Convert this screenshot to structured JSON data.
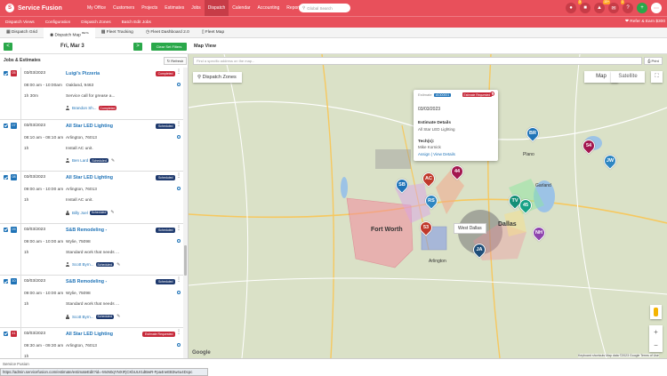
{
  "app": {
    "brand": "Service Fusion",
    "logo_letter": "S",
    "brand_color": "#e8505b"
  },
  "nav": {
    "items": [
      "My Office",
      "Customers",
      "Projects",
      "Estimates",
      "Jobs",
      "Dispatch",
      "Calendar",
      "Accounting",
      "Reports"
    ],
    "active": "Dispatch"
  },
  "search": {
    "placeholder": "Global Search",
    "icon": "search-icon"
  },
  "topicons": {
    "badge1": "3",
    "badge2": "10+",
    "badge3": "1"
  },
  "subnav": {
    "items": [
      "Dispatch Views",
      "Configuration",
      "Dispatch Zones",
      "Batch Edit Jobs"
    ],
    "refer": "Refer & Earn $300"
  },
  "tabs": {
    "items": [
      "Dispatch Grid",
      "Dispatch Map",
      "Fleet Tracking",
      "Fleet Dashboard 2.0",
      "Fleet Map"
    ],
    "beta": "BETA"
  },
  "controls": {
    "prev": "<",
    "next": ">",
    "date": "Fri, Mar 3",
    "clear": "Clear Set Filters",
    "map_view": "Map View"
  },
  "left": {
    "title": "Jobs & Estimates",
    "refresh": "Refresh"
  },
  "jobs": [
    {
      "num": "05",
      "color": "#c62839",
      "date": "03/03/2023",
      "time": "08:00 am - 10:00am",
      "duration": "1h 30m",
      "name": "Luigi's Pizzeria",
      "address": "Oakland, 9463",
      "desc": "Service call for grease a...",
      "tech": "Brandon Sh...",
      "tech_status": "Completed",
      "status": "Completed",
      "status_color": "#c62839",
      "tb_red": true
    },
    {
      "num": "07",
      "color": "#1f73b7",
      "date": "03/03/2023",
      "time": "08:10 am - 08:10 am",
      "duration": "1h",
      "name": "All Star LED Lighting",
      "address": "Arlington, 76013",
      "desc": "Install AC unit.",
      "tech": "Ben Lard",
      "tech_status": "Scheduled",
      "status": "Scheduled",
      "status_color": "#1f3a6e",
      "tb_red": false
    },
    {
      "num": "08",
      "color": "#1f73b7",
      "date": "03/03/2023",
      "time": "09:00 am - 10:00 am",
      "duration": "1h",
      "name": "All Star LED Lighting",
      "address": "Arlington, 76013",
      "desc": "Install AC unit.",
      "tech": "Billy Joel",
      "tech_status": "Scheduled",
      "status": "Scheduled",
      "status_color": "#1f3a6e",
      "tb_red": false
    },
    {
      "num": "09",
      "color": "#1f73b7",
      "date": "03/03/2023",
      "time": "09:00 am - 10:00 am",
      "duration": "1h",
      "name": "S&B Remodeling -",
      "address": "Wylie, 75098",
      "desc": "Standard work that needs ...",
      "tech": "Scott Byrn...",
      "tech_status": "Scheduled",
      "status": "Scheduled",
      "status_color": "#1f3a6e",
      "tb_red": false
    },
    {
      "num": "10",
      "color": "#1f73b7",
      "date": "03/03/2023",
      "time": "09:00 am - 10:00 am",
      "duration": "1h",
      "name": "S&B Remodeling -",
      "address": "Wylie, 75098",
      "desc": "Standard work that needs ...",
      "tech": "Scott Byrn...",
      "tech_status": "Scheduled",
      "status": "Scheduled",
      "status_color": "#1f3a6e",
      "tb_red": false
    },
    {
      "num": "41",
      "color": "#c62839",
      "date": "03/03/2023",
      "time": "09:30 am - 09:30 am",
      "duration": "1h",
      "name": "All Star LED Lighting",
      "address": "Arlington, 76013",
      "desc": "",
      "tech": "",
      "tech_status": "",
      "status": "Estimate Requested",
      "status_color": "#c62839",
      "tb_red": true
    }
  ],
  "map": {
    "address_placeholder": "Find a specific address on the map...",
    "print": "Print",
    "zones_btn": "Dispatch Zones",
    "type_map": "Map",
    "type_sat": "Satellite",
    "fullscreen": "⛶",
    "popup": {
      "est_label": "Estimate",
      "est_num": "#1000001",
      "badge": "Estimate Requested",
      "close": "x",
      "date": "03/03/2023",
      "details_h": "Estimate Details",
      "details_v": "All Star LED Lighting",
      "tech_h": "Tech(s):",
      "tech_v": "Mike Kornick",
      "link": "Assign | View Details"
    },
    "city_labels": [
      "Fort Worth",
      "Dallas",
      "Garland",
      "Plano",
      "Arlington"
    ],
    "zone_label": "West Dallas",
    "google": "Google",
    "attribution": "Keyboard shortcuts   Map data ©2023 Google   Terms of Use",
    "zoom_in": "+",
    "zoom_out": "−",
    "pins": [
      {
        "label": "54",
        "color": "#a3174f"
      },
      {
        "label": "44",
        "color": "#a3174f"
      },
      {
        "label": "SB",
        "color": "#1f73b7"
      },
      {
        "label": "AC",
        "color": "#c0392b"
      },
      {
        "label": "RS",
        "color": "#2e86c1"
      },
      {
        "label": "TV",
        "color": "#148f77"
      },
      {
        "label": "45",
        "color": "#16a085"
      },
      {
        "label": "53",
        "color": "#c0392b"
      },
      {
        "label": "JA",
        "color": "#1f4e79"
      },
      {
        "label": "JW",
        "color": "#2e86c1"
      },
      {
        "label": "NH",
        "color": "#8e44ad"
      },
      {
        "label": "BR",
        "color": "#1f73b7"
      }
    ]
  },
  "footer": {
    "company": "Service Fusion",
    "url": "https://admin.servicefusion.com/estimate/estimateEdit?id=-MxN0qYNXIFjCKbUUr1dBwR-Fpa4neEB3w4u4Dcpc"
  }
}
